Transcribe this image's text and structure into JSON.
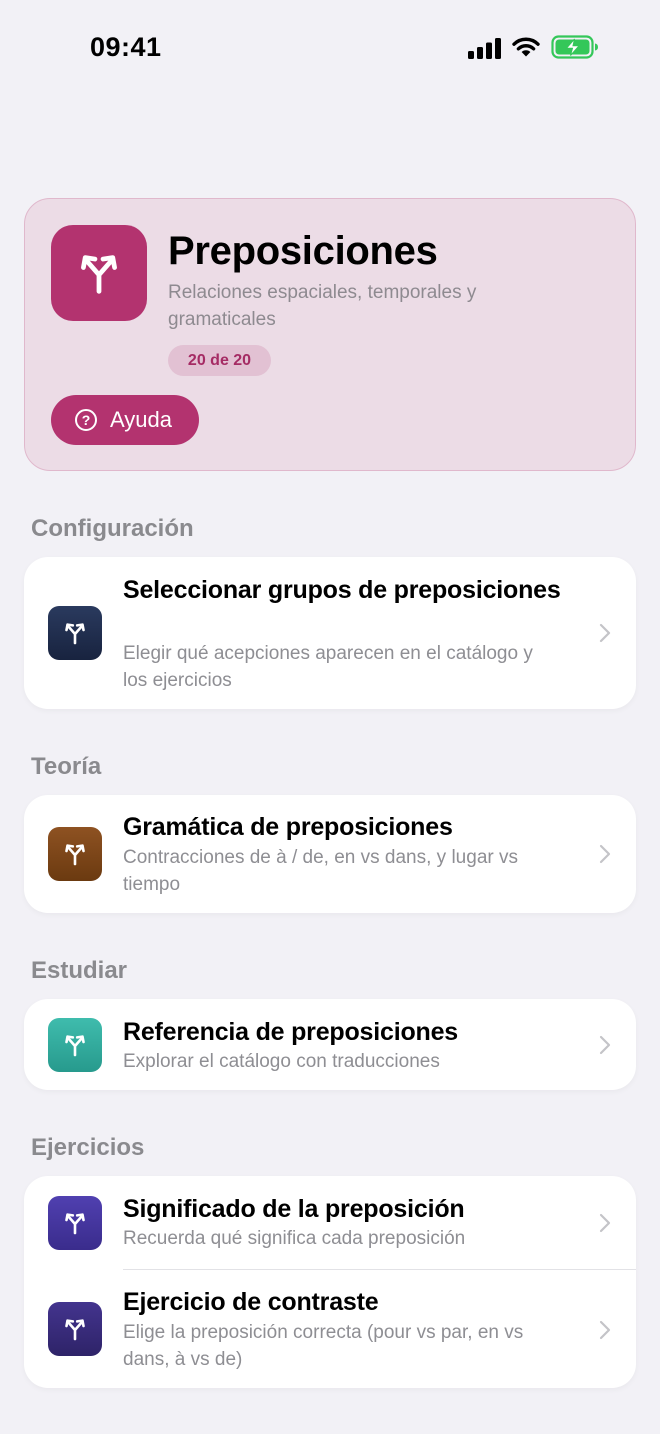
{
  "status_bar": {
    "time": "09:41"
  },
  "hero": {
    "title": "Preposiciones",
    "subtitle": "Relaciones espaciales, temporales y gramaticales",
    "badge": "20 de 20",
    "help_label": "Ayuda",
    "help_icon_glyph": "?",
    "icon": "fork-arrows-icon",
    "accent_color": "#b3336f"
  },
  "sections": [
    {
      "header": "Configuración",
      "items": [
        {
          "title": "Seleccionar grupos de preposiciones",
          "description": "Elegir qué acepciones aparecen en el catálogo y los ejercicios",
          "icon_color": "#1c2a4a"
        }
      ]
    },
    {
      "header": "Teoría",
      "items": [
        {
          "title": "Gramática de preposiciones",
          "description": "Contracciones de à / de, en vs dans, y lugar vs tiempo",
          "icon_color": "#7a4214"
        }
      ]
    },
    {
      "header": "Estudiar",
      "items": [
        {
          "title": "Referencia de preposiciones",
          "description": "Explorar el catálogo con traducciones",
          "icon_color": "#2fa89a"
        }
      ]
    },
    {
      "header": "Ejercicios",
      "items": [
        {
          "title": "Significado de la preposición",
          "description": "Recuerda qué significa cada preposición",
          "icon_color": "#43319c"
        },
        {
          "title": "Ejercicio de contraste",
          "description": "Elige la preposición correcta (pour vs par, en vs dans, à vs de)",
          "icon_color": "#352878"
        }
      ]
    }
  ]
}
